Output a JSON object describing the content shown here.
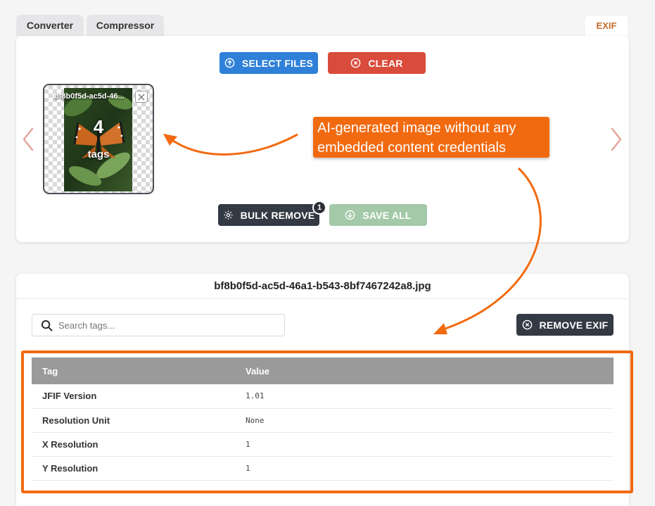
{
  "tabs": [
    {
      "label": "Converter"
    },
    {
      "label": "Compressor"
    },
    {
      "label": "EXIF"
    }
  ],
  "upload": {
    "select_files_label": "SELECT FILES",
    "clear_label": "CLEAR",
    "bulk_remove_label": "BULK REMOVE",
    "bulk_remove_badge": "1",
    "save_all_label": "SAVE ALL"
  },
  "thumbnail": {
    "filename": "bf8b0f5d-ac5d-46...",
    "tag_count": "4",
    "tag_count_label": "tags"
  },
  "annotation": {
    "text": "AI-generated image without any embedded content credentials"
  },
  "exif": {
    "filename": "bf8b0f5d-ac5d-46a1-b543-8bf7467242a8.jpg",
    "search_placeholder": "Search tags...",
    "remove_exif_label": "REMOVE EXIF",
    "columns": [
      "Tag",
      "Value"
    ],
    "rows": [
      {
        "tag": "JFIF Version",
        "value": "1.01"
      },
      {
        "tag": "Resolution Unit",
        "value": "None"
      },
      {
        "tag": "X Resolution",
        "value": "1"
      },
      {
        "tag": "Y Resolution",
        "value": "1"
      }
    ]
  },
  "colors": {
    "primary": "#2f80d8",
    "danger": "#d94b3b",
    "dark": "#343a44",
    "success_disabled": "#a4c9a8",
    "annotation": "#f26a10",
    "active_tab_text": "#c56a2f"
  },
  "icons": {
    "select_files": "upload-circle-icon",
    "clear": "x-circle-icon",
    "bulk_remove": "gear-icon",
    "save_all": "download-circle-icon",
    "remove_exif": "x-circle-icon",
    "search": "search-icon",
    "thumbnail_close": "close-icon",
    "prev": "chevron-left-icon",
    "next": "chevron-right-icon"
  }
}
